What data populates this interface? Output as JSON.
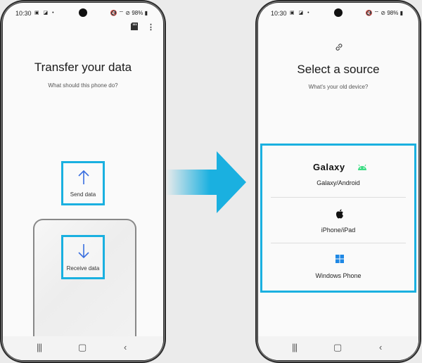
{
  "status_bar": {
    "time": "10:30",
    "battery": "98%"
  },
  "left_screen": {
    "title": "Transfer your data",
    "subtitle": "What should this phone do?",
    "send_label": "Send data",
    "receive_label": "Receive data"
  },
  "right_screen": {
    "title": "Select a source",
    "subtitle": "What's your old device?",
    "options": [
      {
        "label": "Galaxy/Android",
        "brand": "Galaxy"
      },
      {
        "label": "iPhone/iPad"
      },
      {
        "label": "Windows Phone"
      }
    ]
  },
  "colors": {
    "highlight": "#1ab0e0",
    "accent": "#3a6fe0",
    "android": "#3ddc84",
    "windows": "#1e88e5"
  },
  "icons": [
    "sd-card-icon",
    "more-vert-icon",
    "link-icon",
    "arrow-up-icon",
    "arrow-down-icon",
    "android-icon",
    "apple-icon",
    "windows-icon",
    "recent-apps-icon",
    "home-icon",
    "back-icon"
  ]
}
